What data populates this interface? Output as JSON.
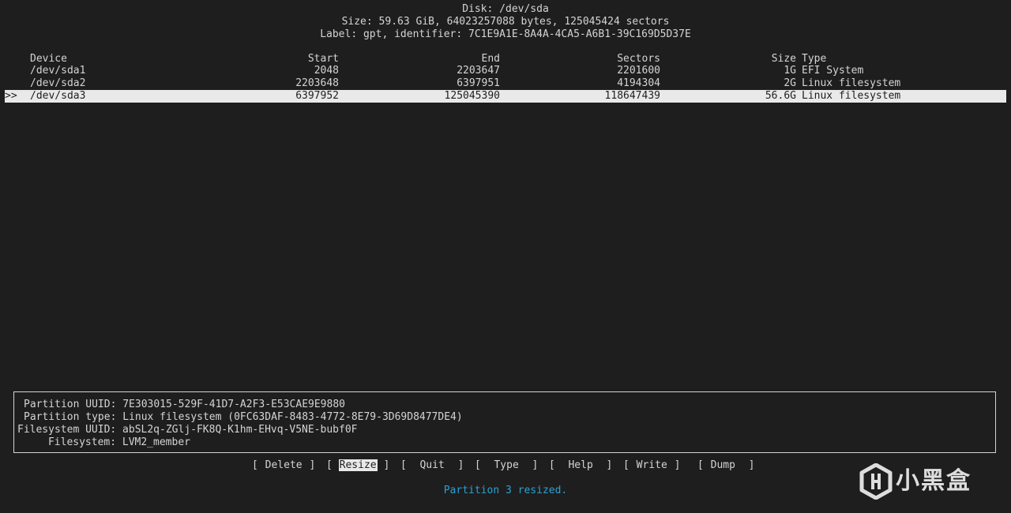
{
  "header": {
    "disk": "Disk: /dev/sda",
    "size": "Size: 59.63 GiB, 64023257088 bytes, 125045424 sectors",
    "label": "Label: gpt, identifier: 7C1E9A1E-8A4A-4CA5-A6B1-39C169D5D37E"
  },
  "table": {
    "headers": {
      "device": "Device",
      "start": "Start",
      "end": "End",
      "sectors": "Sectors",
      "size": "Size",
      "type": "Type"
    },
    "selected_marker": ">>",
    "rows": [
      {
        "device": "/dev/sda1",
        "start": "2048",
        "end": "2203647",
        "sectors": "2201600",
        "size": "1G",
        "type": "EFI System"
      },
      {
        "device": "/dev/sda2",
        "start": "2203648",
        "end": "6397951",
        "sectors": "4194304",
        "size": "2G",
        "type": "Linux filesystem"
      },
      {
        "device": "/dev/sda3",
        "start": "6397952",
        "end": "125045390",
        "sectors": "118647439",
        "size": "56.6G",
        "type": "Linux filesystem"
      }
    ]
  },
  "info": {
    "partition_uuid": "Partition UUID: 7E303015-529F-41D7-A2F3-E53CAE9E9880",
    "partition_type": "Partition type: Linux filesystem (0FC63DAF-8483-4772-8E79-3D69D8477DE4)",
    "filesystem_uuid": "Filesystem UUID: abSL2q-ZGlj-FK8Q-K1hm-EHvq-V5NE-bubf0F",
    "filesystem": "      Filesystem: LVM2_member"
  },
  "menu": {
    "delete": "Delete",
    "resize": "Resize",
    "quit": "Quit",
    "type": "Type",
    "help": "Help",
    "write": "Write",
    "dump": "Dump"
  },
  "status": "Partition 3 resized.",
  "watermark": {
    "text": "小黑盒",
    "icon": "heybox-logo-icon"
  }
}
